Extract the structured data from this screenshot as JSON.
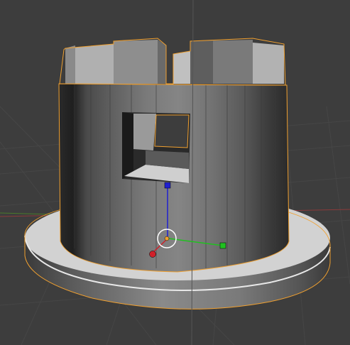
{
  "viewport": {
    "background": "#3d3d3d",
    "grid_color": "#464646",
    "axis_x_color": "#8c3a3a",
    "axis_y_color": "#5a8a2a",
    "selection_outline_color": "#f0a030"
  },
  "object": {
    "name": "tower",
    "selected": true,
    "parts": [
      "base-disc",
      "cylinder-wall",
      "battlements",
      "window-opening"
    ]
  },
  "gizmo": {
    "x_handle_color": "#d0202a",
    "y_handle_color": "#20c020",
    "z_handle_color": "#2020d0",
    "pivot_color": "#f0a030"
  },
  "icons": {
    "origin": "origin-icon",
    "x_handle": "x-axis-handle-icon",
    "y_handle": "y-axis-handle-icon",
    "z_handle": "z-axis-handle-icon"
  }
}
